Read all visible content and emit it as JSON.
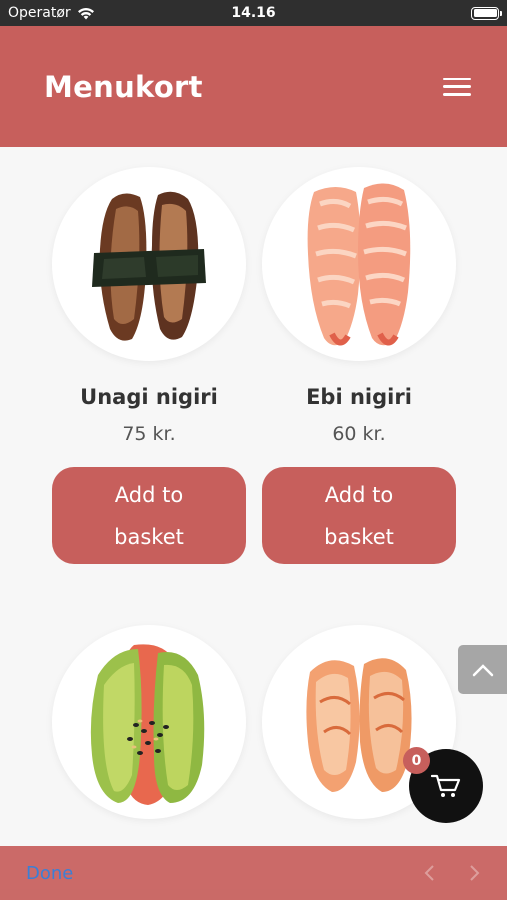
{
  "status_bar": {
    "carrier": "Operatør",
    "time": "14.16"
  },
  "header": {
    "title": "Menukort",
    "menu_icon": "hamburger-menu-icon"
  },
  "products": [
    {
      "name": "Unagi nigiri",
      "price": "75 kr.",
      "button_label": "Add to basket"
    },
    {
      "name": "Ebi nigiri",
      "price": "60 kr.",
      "button_label": "Add to basket"
    },
    {
      "name": "",
      "price": "",
      "button_label": ""
    },
    {
      "name": "",
      "price": "",
      "button_label": ""
    }
  ],
  "cart": {
    "count": "0",
    "icon": "shopping-cart-icon"
  },
  "scroll_top_icon": "chevron-up-icon",
  "toolbar": {
    "done_label": "Done",
    "prev_icon": "chevron-left-icon",
    "next_icon": "chevron-right-icon"
  },
  "colors": {
    "brand": "#c75f5c",
    "status_bar": "#2f2f2f",
    "cart": "#111111",
    "done_text": "#3b7fd6"
  }
}
